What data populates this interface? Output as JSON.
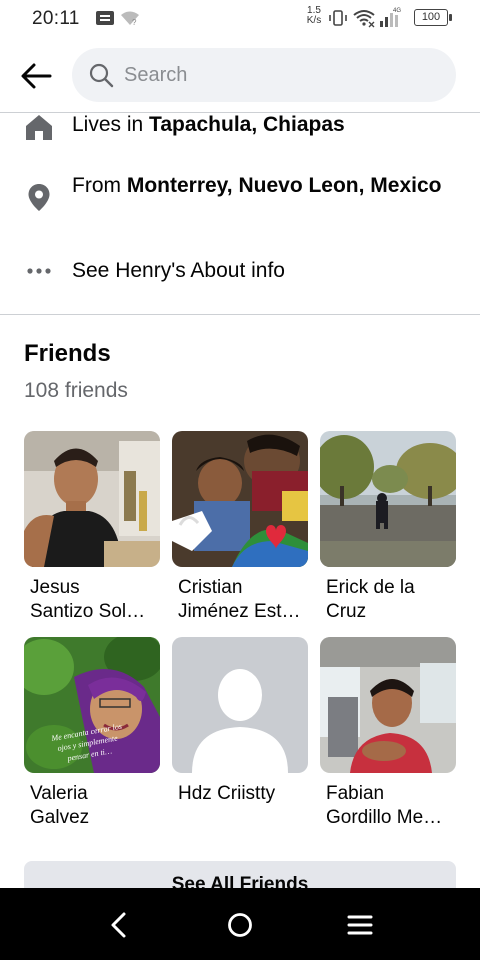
{
  "status_bar": {
    "time": "20:11",
    "speed_value": "1.5",
    "speed_unit": "K/s",
    "network": "4G",
    "battery": "100"
  },
  "header": {
    "search_placeholder": "Search"
  },
  "about": {
    "lives_prefix": "Lives in ",
    "lives_place": "Tapachula, Chiapas",
    "from_prefix": "From ",
    "from_place": "Monterrey, Nuevo Leon, Mexico",
    "see_about": "See Henry's About info"
  },
  "friends": {
    "title": "Friends",
    "count": "108 friends",
    "items": [
      {
        "line1": "Jesus",
        "line2": "Santizo Sol…"
      },
      {
        "line1": "Cristian",
        "line2": "Jiménez Est…"
      },
      {
        "line1": "Erick de la",
        "line2": "Cruz"
      },
      {
        "line1": "Valeria",
        "line2": "Galvez"
      },
      {
        "line1": "Hdz Criistty",
        "line2": ""
      },
      {
        "line1": "Fabian",
        "line2": "Gordillo Me…"
      }
    ],
    "see_all": "See All Friends",
    "photo_caption": "Me encanta cerrar los ojos y simplemente pensar en ti…"
  },
  "colors": {
    "divider": "#cdd0d4",
    "search_bg": "#f0f2f5",
    "secondary_text": "#65676b",
    "button_bg": "#e4e6eb",
    "nav_bg": "#000000"
  },
  "icons": {
    "back": "arrow-left-icon",
    "search": "magnifier-icon",
    "home": "house-icon",
    "location": "map-pin-icon",
    "more": "more-dots-icon"
  }
}
